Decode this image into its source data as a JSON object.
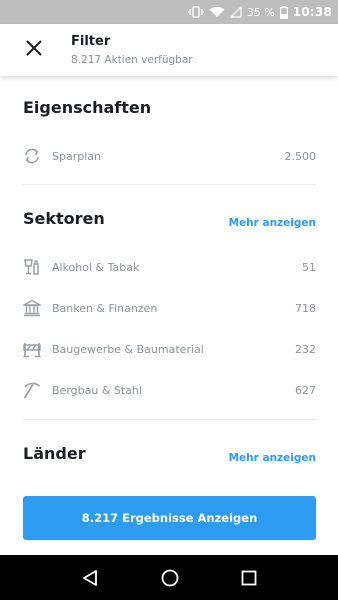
{
  "status_bar": {
    "battery_percent": "35 %",
    "time": "10:38",
    "icons": [
      "vibrate-icon",
      "wifi-icon",
      "signal-icon",
      "battery-icon"
    ]
  },
  "header": {
    "title": "Filter",
    "subtitle": "8.217 Aktien verfügbar",
    "close_icon": "close-icon"
  },
  "properties": {
    "title": "Eigenschaften",
    "items": [
      {
        "icon": "refresh-icon",
        "label": "Sparplan",
        "count": "2.500"
      }
    ]
  },
  "sectors": {
    "title": "Sektoren",
    "more_label": "Mehr anzeigen",
    "items": [
      {
        "icon": "drinks-icon",
        "label": "Alkohol & Tabak",
        "count": "51"
      },
      {
        "icon": "bank-icon",
        "label": "Banken & Finanzen",
        "count": "718"
      },
      {
        "icon": "construction-icon",
        "label": "Baugewerbe & Baumaterial",
        "count": "232"
      },
      {
        "icon": "pickaxe-icon",
        "label": "Bergbau & Stahl",
        "count": "627"
      }
    ]
  },
  "countries": {
    "title": "Länder",
    "more_label": "Mehr anzeigen"
  },
  "results_button": {
    "label": "8.217 Ergebnisse Anzeigen"
  },
  "nav_bar": {
    "icons": [
      "back-icon",
      "home-icon",
      "recents-icon"
    ]
  },
  "colors": {
    "accent": "#2d9cf0",
    "text_primary": "#1b1f23",
    "text_secondary": "#8d9298",
    "status_bar": "#bdbdbd",
    "nav_bar": "#000000"
  }
}
